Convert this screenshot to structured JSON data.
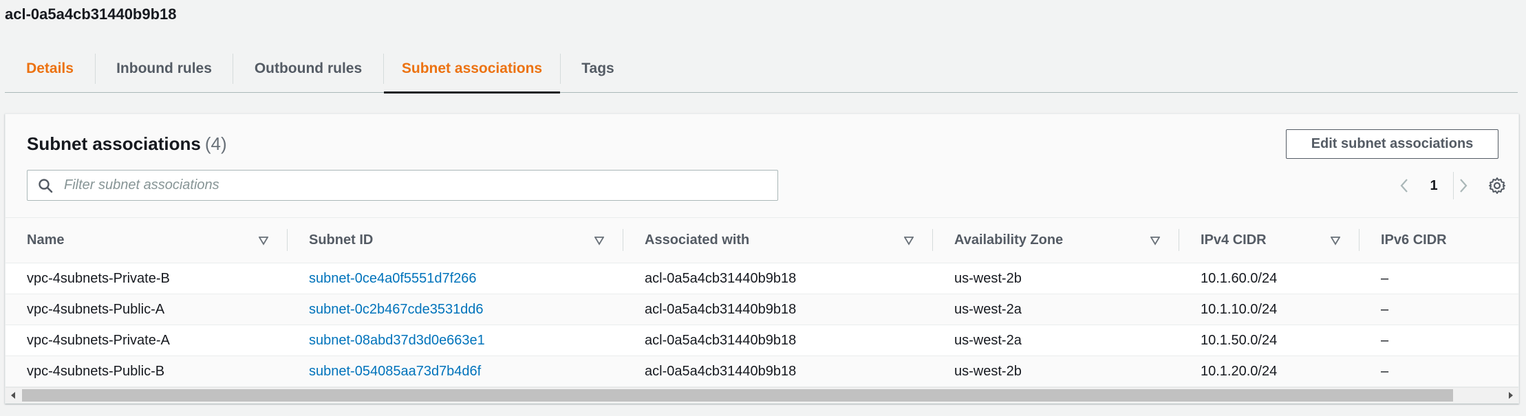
{
  "header": {
    "acl_id": "acl-0a5a4cb31440b9b18"
  },
  "tabs": [
    {
      "label": "Details"
    },
    {
      "label": "Inbound rules"
    },
    {
      "label": "Outbound rules"
    },
    {
      "label": "Subnet associations"
    },
    {
      "label": "Tags"
    }
  ],
  "panel": {
    "title": "Subnet associations",
    "count": "(4)",
    "edit_button": "Edit subnet associations",
    "filter_placeholder": "Filter subnet associations",
    "page_number": "1"
  },
  "table": {
    "columns": [
      "Name",
      "Subnet ID",
      "Associated with",
      "Availability Zone",
      "IPv4 CIDR",
      "IPv6 CIDR"
    ],
    "rows": [
      {
        "name": "vpc-4subnets-Private-B",
        "subnet_id": "subnet-0ce4a0f5551d7f266",
        "associated": "acl-0a5a4cb31440b9b18",
        "az": "us-west-2b",
        "ipv4": "10.1.60.0/24",
        "ipv6": "–"
      },
      {
        "name": "vpc-4subnets-Public-A",
        "subnet_id": "subnet-0c2b467cde3531dd6",
        "associated": "acl-0a5a4cb31440b9b18",
        "az": "us-west-2a",
        "ipv4": "10.1.10.0/24",
        "ipv6": "–"
      },
      {
        "name": "vpc-4subnets-Private-A",
        "subnet_id": "subnet-08abd37d3d0e663e1",
        "associated": "acl-0a5a4cb31440b9b18",
        "az": "us-west-2a",
        "ipv4": "10.1.50.0/24",
        "ipv6": "–"
      },
      {
        "name": "vpc-4subnets-Public-B",
        "subnet_id": "subnet-054085aa73d7b4d6f",
        "associated": "acl-0a5a4cb31440b9b18",
        "az": "us-west-2b",
        "ipv4": "10.1.20.0/24",
        "ipv6": "–"
      }
    ]
  },
  "colors": {
    "accent_orange": "#ec7211",
    "link_blue": "#0073bb"
  }
}
